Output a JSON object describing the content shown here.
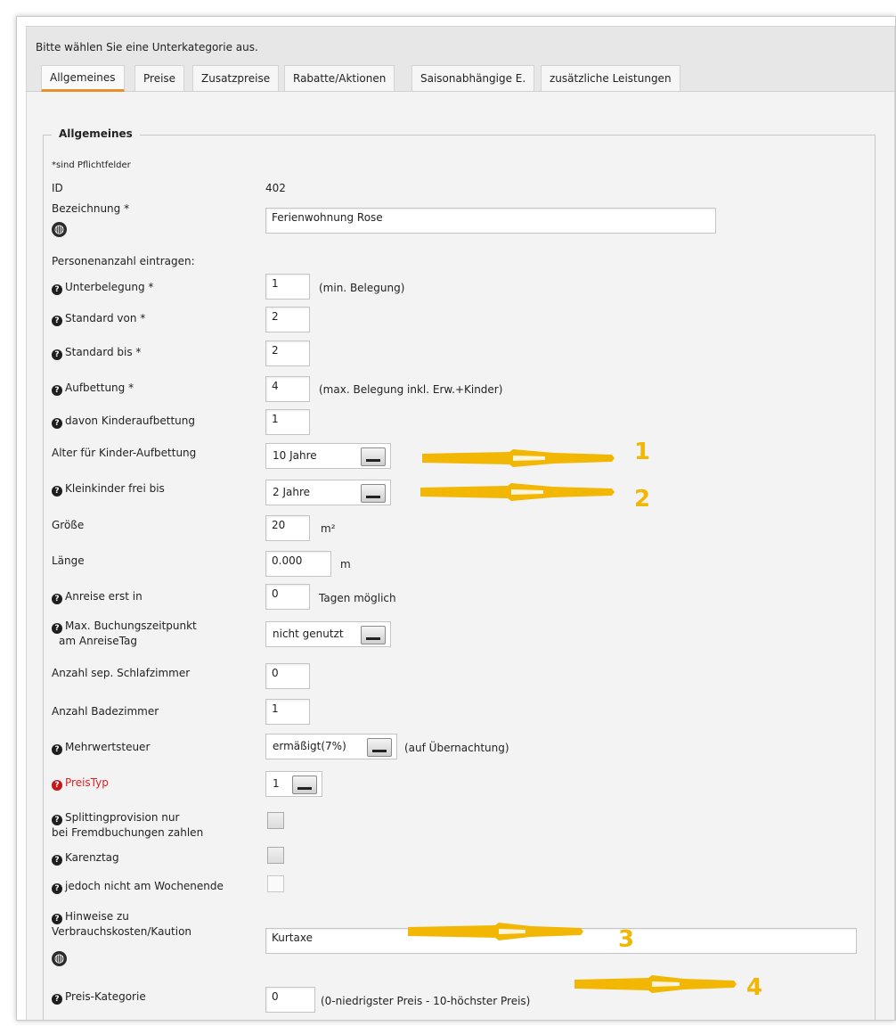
{
  "header": {
    "subcategory_prompt": "Bitte wählen Sie eine Unterkategorie aus.",
    "tabs": [
      {
        "label": "Allgemeines",
        "active": true
      },
      {
        "label": "Preise"
      },
      {
        "label": "Zusatzpreise"
      },
      {
        "label": "Rabatte/Aktionen"
      },
      {
        "label": "Saisonabhängige E."
      },
      {
        "label": "zusätzliche Leistungen"
      }
    ]
  },
  "section": {
    "legend": "Allgemeines",
    "required_note": "*sind Pflichtfelder",
    "id_label": "ID",
    "id_value": "402",
    "bezeichnung_label": "Bezeichnung *",
    "bezeichnung_value": "Ferienwohnung Rose",
    "personen_heading": "Personenanzahl eintragen:",
    "unterbelegung_label": "Unterbelegung *",
    "unterbelegung_value": "1",
    "unterbelegung_hint": "(min. Belegung)",
    "standard_von_label": "Standard von *",
    "standard_von_value": "2",
    "standard_bis_label": "Standard bis *",
    "standard_bis_value": "2",
    "aufbettung_label": "Aufbettung *",
    "aufbettung_value": "4",
    "aufbettung_hint": "(max. Belegung inkl. Erw.+Kinder)",
    "kinderaufbettung_label": "davon Kinderaufbettung",
    "kinderaufbettung_value": "1",
    "alter_label": "Alter für Kinder-Aufbettung",
    "alter_value": "10 Jahre",
    "kleinkinder_label": "Kleinkinder frei bis",
    "kleinkinder_value": "2 Jahre",
    "groesse_label": "Größe",
    "groesse_value": "20",
    "groesse_unit": "m²",
    "laenge_label": "Länge",
    "laenge_value": "0.000",
    "laenge_unit": "m",
    "anreise_label": "Anreise erst in",
    "anreise_value": "0",
    "anreise_hint": "Tagen möglich",
    "buchung_label_1": "Max. Buchungszeitpunkt",
    "buchung_label_2": "am AnreiseTag",
    "buchung_value": "nicht genutzt",
    "schlafzimmer_label": "Anzahl sep. Schlafzimmer",
    "schlafzimmer_value": "0",
    "badezimmer_label": "Anzahl Badezimmer",
    "badezimmer_value": "1",
    "mwst_label": "Mehrwertsteuer",
    "mwst_value": "ermäßigt(7%)",
    "mwst_hint": "(auf Übernachtung)",
    "preistyp_label": "PreisTyp",
    "preistyp_value": "1",
    "splitting_label_1": "Splittingprovision nur",
    "splitting_label_2": "bei Fremdbuchungen zahlen",
    "karenztag_label": "Karenztag",
    "wochenende_label": "jedoch nicht am Wochenende",
    "hinweise_label_1": "Hinweise zu",
    "hinweise_label_2": "Verbrauchskosten/Kaution",
    "hinweise_value": "Kurtaxe",
    "preiskat_label": "Preis-Kategorie",
    "preiskat_value": "0",
    "preiskat_hint": "(0-niedrigster Preis - 10-höchster Preis)"
  },
  "annotations": {
    "color": "#f2b705",
    "numbers": [
      "1",
      "2",
      "3",
      "4"
    ]
  },
  "icons": {
    "help": "question-circle-icon",
    "globe": "globe-icon"
  }
}
